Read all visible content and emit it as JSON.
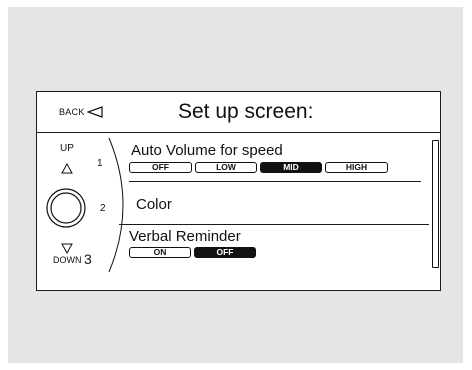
{
  "screen": {
    "back_label": "BACK",
    "title": "Set up screen:"
  },
  "knob": {
    "up_label": "UP",
    "down_label": "DOWN",
    "position_1": "1",
    "position_2": "2",
    "position_3": "3"
  },
  "menu": {
    "items": [
      {
        "label": "Auto Volume for speed",
        "options": [
          {
            "label": "OFF",
            "selected": false
          },
          {
            "label": "LOW",
            "selected": false
          },
          {
            "label": "MID",
            "selected": true
          },
          {
            "label": "HIGH",
            "selected": false
          }
        ]
      },
      {
        "label": "Color"
      },
      {
        "label": "Verbal Reminder",
        "options": [
          {
            "label": "ON",
            "selected": false
          },
          {
            "label": "OFF",
            "selected": true
          }
        ]
      }
    ]
  },
  "colors": {
    "background": "#e5e5e5",
    "screen": "#ffffff",
    "ink": "#111111"
  }
}
